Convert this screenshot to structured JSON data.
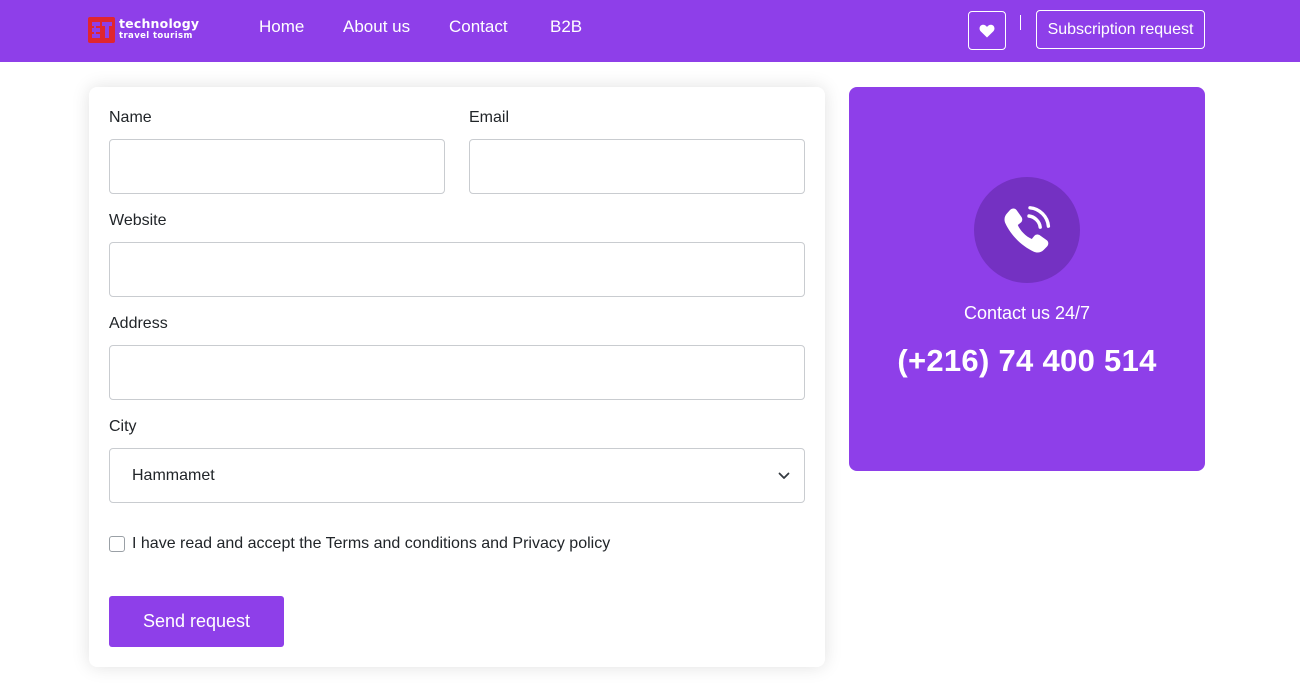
{
  "colors": {
    "brand": "#8e3fe9",
    "brand_dark": "#7431c2",
    "logo_red": "#e0262f"
  },
  "header": {
    "logo": {
      "line1": "TECHNOLOGY",
      "line2": "TRAVEL TOURISM",
      "mark": "3T"
    },
    "nav": [
      {
        "label": "Home"
      },
      {
        "label": "About us"
      },
      {
        "label": "Contact"
      },
      {
        "label": "B2B"
      }
    ],
    "favorites_icon": "heart-icon",
    "subscription_label": "Subscription request"
  },
  "form": {
    "name": {
      "label": "Name",
      "value": "",
      "placeholder": ""
    },
    "email": {
      "label": "Email",
      "value": "",
      "placeholder": ""
    },
    "website": {
      "label": "Website",
      "value": "",
      "placeholder": ""
    },
    "address": {
      "label": "Address",
      "value": "",
      "placeholder": ""
    },
    "city": {
      "label": "City",
      "selected": "Hammamet"
    },
    "terms": {
      "checked": false,
      "label": "I have read and accept the Terms and conditions and Privacy policy"
    },
    "submit_label": "Send request"
  },
  "contact": {
    "icon": "phone-call-icon",
    "label": "Contact us 24/7",
    "phone": "(+216) 74 400 514"
  }
}
